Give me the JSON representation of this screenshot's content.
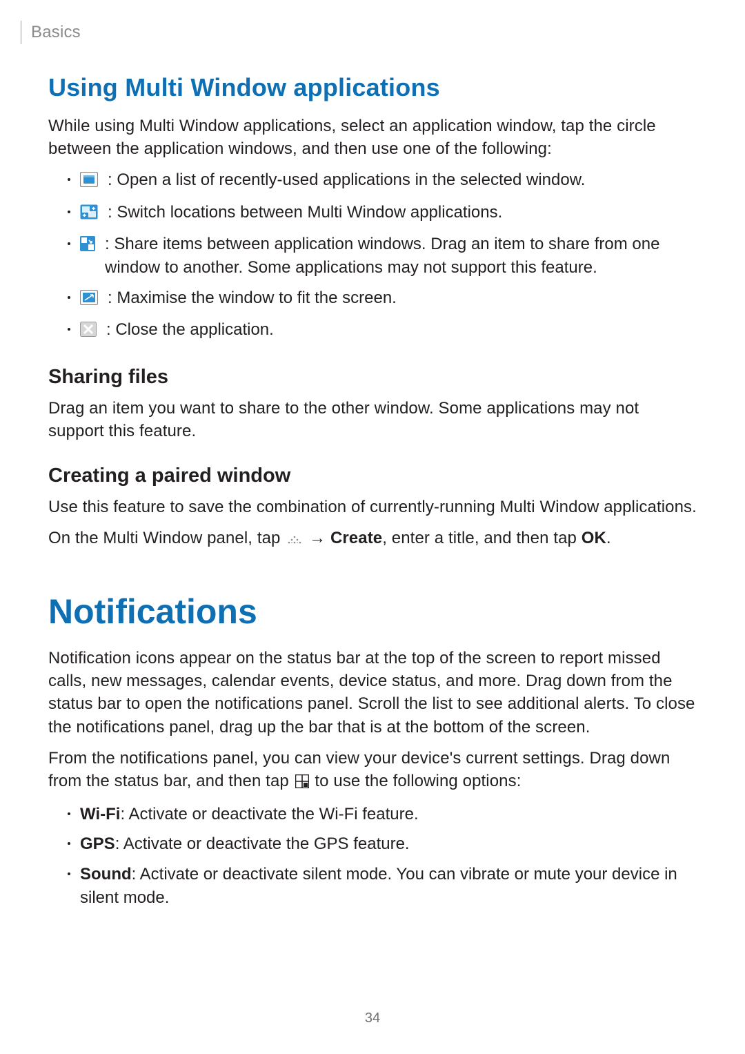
{
  "header": {
    "section": "Basics"
  },
  "s1": {
    "title": "Using Multi Window applications",
    "intro": "While using Multi Window applications, select an application window, tap the circle between the application windows, and then use one of the following:",
    "items": [
      {
        "icon": "recent-apps-icon",
        "text": " : Open a list of recently-used applications in the selected window."
      },
      {
        "icon": "switch-windows-icon",
        "text": " : Switch locations between Multi Window applications."
      },
      {
        "icon": "share-items-icon",
        "text": " : Share items between application windows. Drag an item to share from one window to another. Some applications may not support this feature."
      },
      {
        "icon": "maximise-icon",
        "text": " : Maximise the window to fit the screen."
      },
      {
        "icon": "close-app-icon",
        "text": " : Close the application."
      }
    ]
  },
  "s2": {
    "title": "Sharing files",
    "body": "Drag an item you want to share to the other window. Some applications may not support this feature."
  },
  "s3": {
    "title": "Creating a paired window",
    "body1": "Use this feature to save the combination of currently-running Multi Window applications.",
    "body2_pre": "On the Multi Window panel, tap ",
    "body2_arrow": " → ",
    "body2_create": "Create",
    "body2_mid": ", enter a title, and then tap ",
    "body2_ok": "OK",
    "body2_end": "."
  },
  "s4": {
    "title": "Notifications",
    "p1": "Notification icons appear on the status bar at the top of the screen to report missed calls, new messages, calendar events, device status, and more. Drag down from the status bar to open the notifications panel. Scroll the list to see additional alerts. To close the notifications panel, drag up the bar that is at the bottom of the screen.",
    "p2_pre": "From the notifications panel, you can view your device's current settings. Drag down from the status bar, and then tap ",
    "p2_post": " to use the following options:",
    "items": [
      {
        "label": "Wi-Fi",
        "text": ": Activate or deactivate the Wi-Fi feature."
      },
      {
        "label": "GPS",
        "text": ": Activate or deactivate the GPS feature."
      },
      {
        "label": "Sound",
        "text": ": Activate or deactivate silent mode. You can vibrate or mute your device in silent mode."
      }
    ]
  },
  "page_number": "34"
}
